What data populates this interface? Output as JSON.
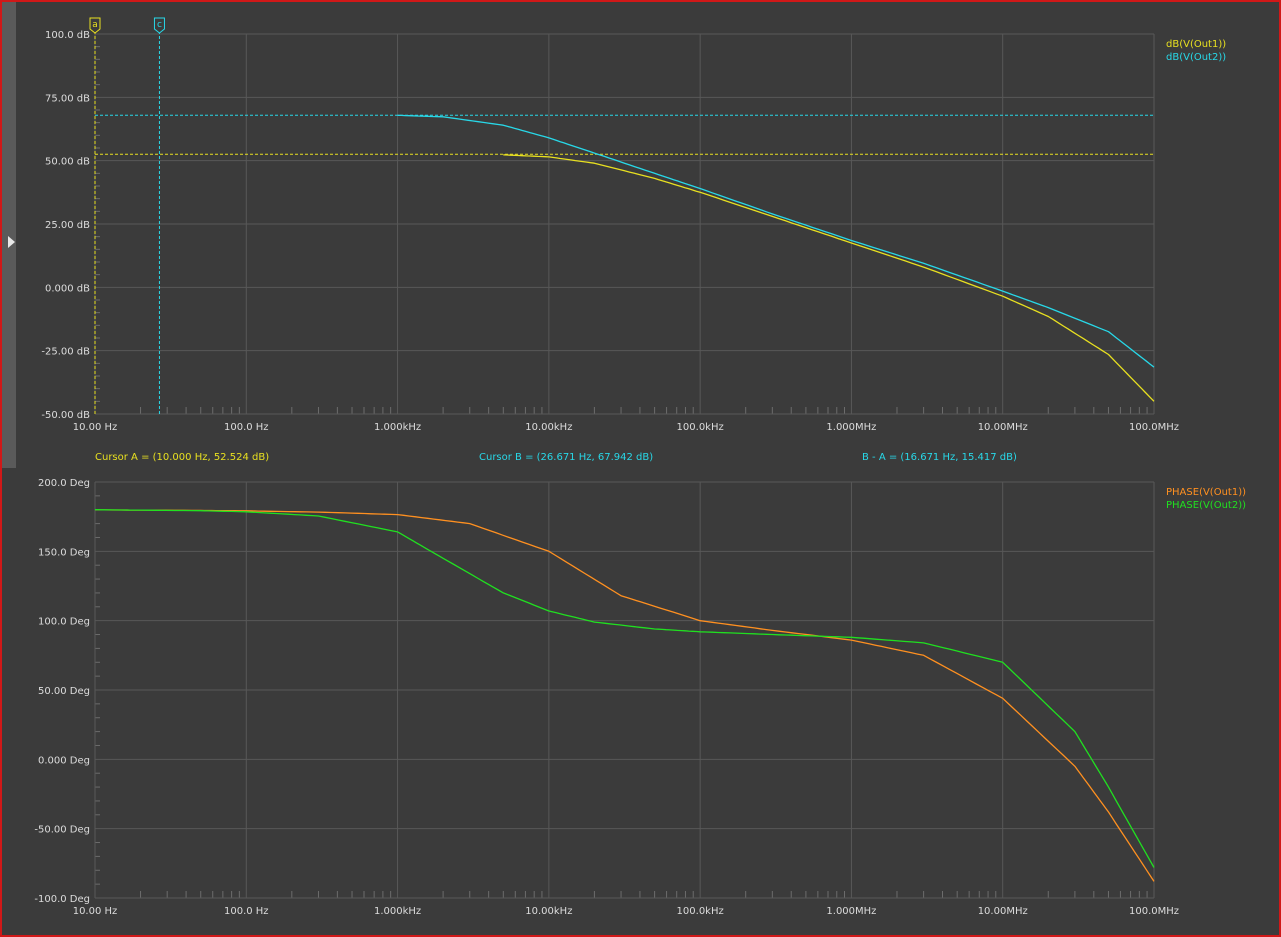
{
  "cursor_readout": {
    "a": "Cursor A = (10.000 Hz, 52.524 dB)",
    "b": "Cursor B = (26.671 Hz, 67.942 dB)",
    "diff": "B - A = (16.671 Hz, 15.417 dB)"
  },
  "cursor_flags": {
    "a": "a",
    "b": "c"
  },
  "colors": {
    "background": "#3b3b3b",
    "grid": "#585858",
    "axis_text": "#dcdcdc",
    "out1_db": "#e8e020",
    "out2_db": "#28d8e8",
    "out1_phase": "#ff9020",
    "out2_phase": "#20e020",
    "frame": "#d01818"
  },
  "chart_data": [
    {
      "type": "line",
      "id": "magnitude",
      "x_scale": "log",
      "xlim": [
        10,
        100000000
      ],
      "x_ticks": [
        10,
        100,
        1000,
        10000,
        100000,
        1000000,
        10000000,
        100000000
      ],
      "x_tick_labels": [
        "10.00 Hz",
        "100.0 Hz",
        "1.000kHz",
        "10.00kHz",
        "100.0kHz",
        "1.000MHz",
        "10.00MHz",
        "100.0MHz"
      ],
      "ylim": [
        -50,
        100
      ],
      "y_ticks": [
        100,
        75,
        50,
        25,
        0,
        -25,
        -50
      ],
      "y_tick_labels": [
        "100.0 dB",
        "75.00 dB",
        "50.00 dB",
        "25.00 dB",
        "0.000 dB",
        "-25.00 dB",
        "-50.00 dB"
      ],
      "grid": true,
      "legend_position": "top-right",
      "series": [
        {
          "name": "dB(V(Out1))",
          "color": "#e8e020",
          "x": [
            5000,
            10000,
            20000,
            50000,
            100000,
            300000,
            1000000,
            3000000,
            10000000,
            20000000,
            50000000,
            100000000
          ],
          "y": [
            52.3,
            51.5,
            49.0,
            43.0,
            37.5,
            28.0,
            17.5,
            8.0,
            -3.5,
            -11.5,
            -26.5,
            -45.0
          ]
        },
        {
          "name": "dB(V(Out2))",
          "color": "#28d8e8",
          "x": [
            1000,
            2000,
            5000,
            10000,
            20000,
            50000,
            100000,
            300000,
            1000000,
            3000000,
            10000000,
            20000000,
            50000000,
            100000000
          ],
          "y": [
            67.9,
            67.3,
            64.0,
            59.0,
            53.0,
            45.0,
            39.0,
            29.0,
            18.5,
            9.5,
            -1.5,
            -8.0,
            -17.5,
            -31.5
          ]
        }
      ],
      "cursors": [
        {
          "label": "a",
          "x": 10,
          "y": 52.524,
          "color": "#e8e020"
        },
        {
          "label": "c",
          "x": 26.671,
          "y": 67.942,
          "color": "#28d8e8"
        }
      ]
    },
    {
      "type": "line",
      "id": "phase",
      "x_scale": "log",
      "xlim": [
        10,
        100000000
      ],
      "x_ticks": [
        10,
        100,
        1000,
        10000,
        100000,
        1000000,
        10000000,
        100000000
      ],
      "x_tick_labels": [
        "10.00 Hz",
        "100.0 Hz",
        "1.000kHz",
        "10.00kHz",
        "100.0kHz",
        "1.000MHz",
        "10.00MHz",
        "100.0MHz"
      ],
      "ylim": [
        -100,
        200
      ],
      "y_ticks": [
        200,
        150,
        100,
        50,
        0,
        -50,
        -100
      ],
      "y_tick_labels": [
        "200.0 Deg",
        "150.0 Deg",
        "100.0 Deg",
        "50.00 Deg",
        "0.000 Deg",
        "-50.00 Deg",
        "-100.0 Deg"
      ],
      "grid": true,
      "legend_position": "top-right",
      "series": [
        {
          "name": "PHASE(V(Out1))",
          "color": "#ff9020",
          "x": [
            10,
            50,
            100,
            300,
            1000,
            3000,
            10000,
            30000,
            100000,
            300000,
            1000000,
            3000000,
            10000000,
            30000000,
            50000000,
            100000000
          ],
          "y": [
            179.9,
            179.5,
            179.2,
            178.3,
            176.5,
            170.0,
            150.0,
            118.0,
            100.0,
            93.0,
            86.0,
            75.0,
            44.0,
            -5.0,
            -38.0,
            -88.0
          ]
        },
        {
          "name": "PHASE(V(Out2))",
          "color": "#20e020",
          "x": [
            10,
            50,
            100,
            300,
            1000,
            2000,
            5000,
            10000,
            20000,
            50000,
            100000,
            300000,
            1000000,
            3000000,
            10000000,
            30000000,
            50000000,
            100000000
          ],
          "y": [
            180.0,
            179.3,
            178.5,
            175.5,
            164.0,
            145.0,
            120.0,
            107.0,
            99.0,
            94.0,
            92.0,
            90.0,
            88.0,
            84.0,
            70.0,
            20.0,
            -20.0,
            -78.0
          ]
        }
      ]
    }
  ]
}
